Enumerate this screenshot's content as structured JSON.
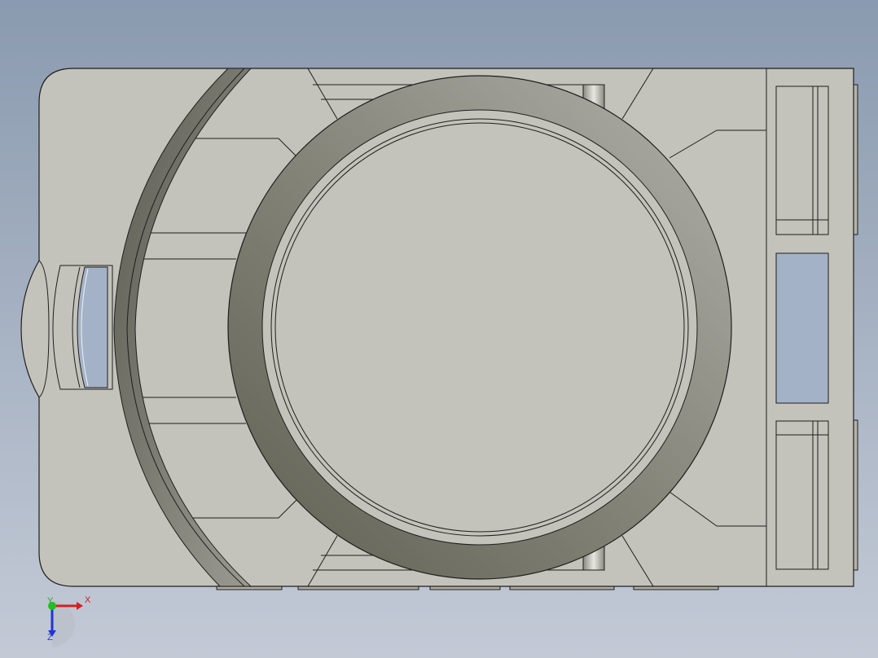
{
  "viewport": {
    "background_top": "#8a9aaf",
    "background_bottom": "#c3cad6"
  },
  "model": {
    "view": "top",
    "body_color": "#c3c3bb",
    "edge_color": "#1e1e1e",
    "ring_color_dark": "#6e6e60",
    "ring_color_light": "#a2a29a",
    "window_color": "#a4b2c8"
  },
  "triad": {
    "x_label": "X",
    "y_label": "Y",
    "z_label": "Z",
    "x_color": "#d42020",
    "y_color": "#20c020",
    "z_color": "#2035d0"
  }
}
